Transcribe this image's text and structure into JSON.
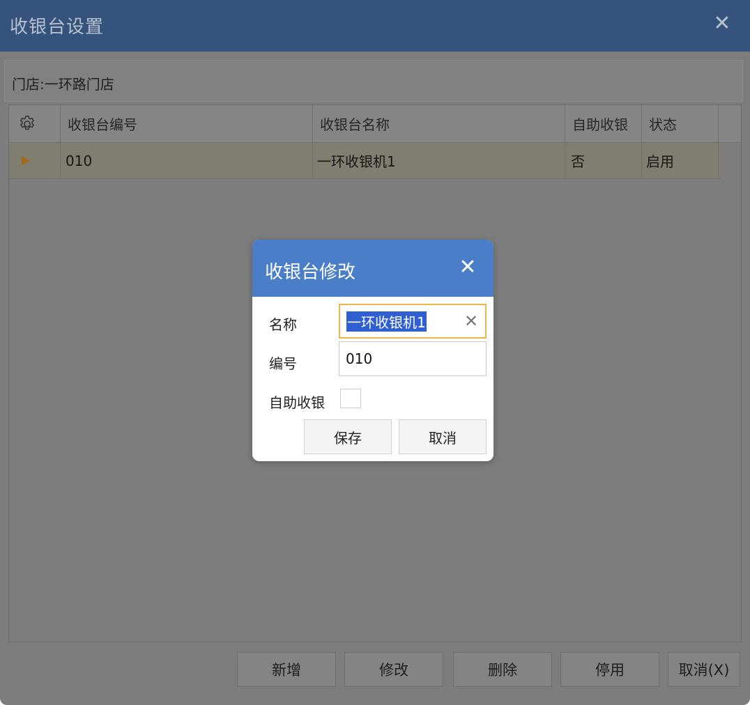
{
  "window": {
    "title": "收银台设置",
    "close_glyph": "✕"
  },
  "store": {
    "label": "门店:",
    "name": "一环路门店"
  },
  "grid": {
    "columns": [
      "收银台编号",
      "收银台名称",
      "自助收银",
      "状态"
    ],
    "rows": [
      {
        "code": "010",
        "name": "一环收银机1",
        "self_service": "否",
        "status": "启用"
      }
    ]
  },
  "toolbar": {
    "add": "新增",
    "edit": "修改",
    "delete": "删除",
    "disable": "停用",
    "cancel": "取消(X)"
  },
  "dialog": {
    "title": "收银台修改",
    "close_glyph": "✕",
    "name_label": "名称",
    "name_value": "一环收银机1",
    "code_label": "编号",
    "code_value": "010",
    "self_label": "自助收银",
    "self_checked": false,
    "save": "保存",
    "cancel": "取消"
  },
  "colors": {
    "titlebar": "#36537d",
    "dialog_header": "#4a7ec8",
    "focus_border": "#f0b44a",
    "selection": "#2f5fd0"
  }
}
